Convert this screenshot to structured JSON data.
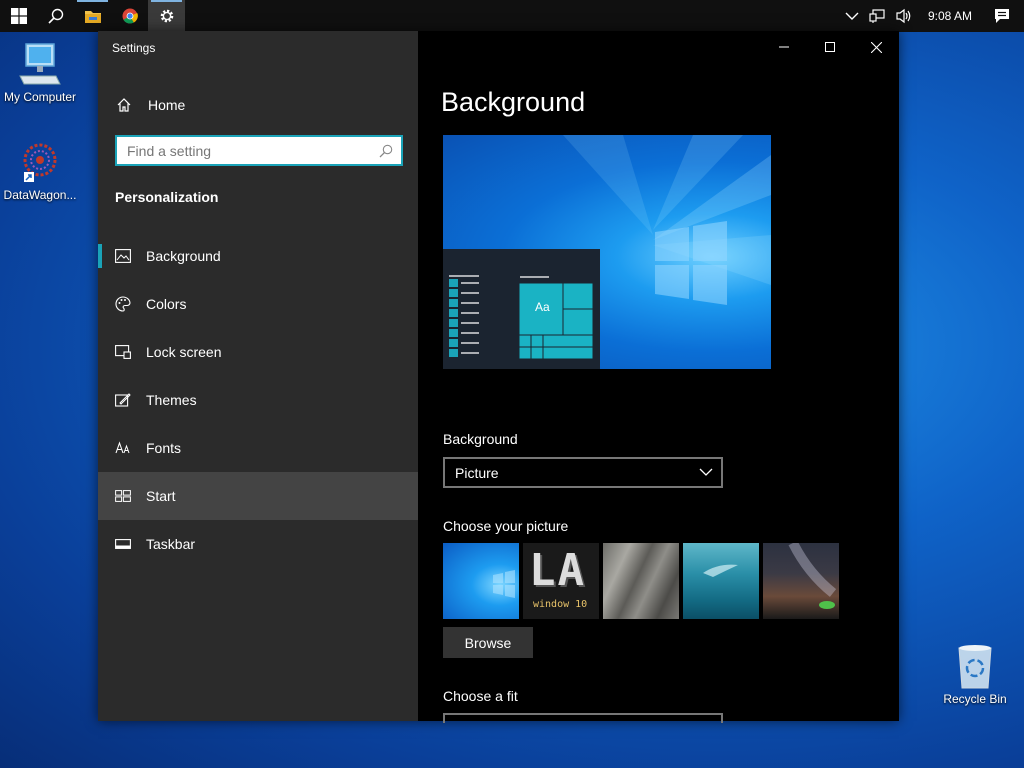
{
  "taskbar": {
    "clock": "9:08 AM",
    "buttons": [
      "start",
      "search",
      "file-explorer",
      "chrome",
      "settings"
    ]
  },
  "desktop": {
    "icons": [
      {
        "label": "My Computer"
      },
      {
        "label": "DataWagon..."
      },
      {
        "label": "Recycle Bin"
      }
    ]
  },
  "window": {
    "title": "Settings",
    "home_label": "Home",
    "search_placeholder": "Find a setting",
    "section": "Personalization",
    "nav": [
      {
        "label": "Background",
        "icon": "picture-icon"
      },
      {
        "label": "Colors",
        "icon": "palette-icon"
      },
      {
        "label": "Lock screen",
        "icon": "lock-screen-icon"
      },
      {
        "label": "Themes",
        "icon": "themes-icon"
      },
      {
        "label": "Fonts",
        "icon": "fonts-icon"
      },
      {
        "label": "Start",
        "icon": "start-icon"
      },
      {
        "label": "Taskbar",
        "icon": "taskbar-icon"
      }
    ],
    "selected_nav": "Background",
    "hovered_nav": "Start"
  },
  "content": {
    "title": "Background",
    "preview_sample_text": "Aa",
    "background_label": "Background",
    "background_value": "Picture",
    "choose_picture_label": "Choose your picture",
    "thumb_text": [
      "LA",
      "window 10"
    ],
    "browse_label": "Browse",
    "choose_fit_label": "Choose a fit"
  },
  "colors": {
    "accent": "#1aa3b8",
    "sidebar_bg": "#2b2b2b",
    "content_bg": "#000000",
    "hover_bg": "#444444"
  }
}
